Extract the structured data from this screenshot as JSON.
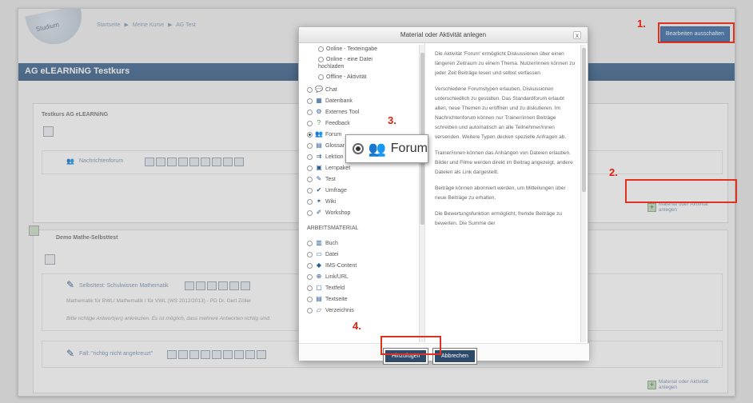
{
  "breadcrumb": [
    "Startseite",
    "▶",
    "Meine Kurse",
    "▶",
    "AG Test"
  ],
  "logo_text": "Studium",
  "edit_button": "Bearbeiten ausschalten",
  "course_title": "AG eLEARNiNG Testkurs",
  "sections": {
    "s0_title": "Testkurs AG eLEARNiNG",
    "forum_link": "Nachrichtenforum",
    "add_activity": "Material oder Aktivität anlegen",
    "s1_title": "Demo Mathe-Selbsttest",
    "quiz_link": "Selbsttest: Schulwissen Mathematik",
    "quiz_info": "Mathematik für BWL/ Mathematik I für VWL (WS 2012/2013) - PD Dr. Gert Zöller",
    "quiz_hint": "Bitte richtige Antwort(en) ankreuzen. Es ist möglich, dass mehrere Antworten richtig sind.",
    "case_link": "Fall: \"richtig nicht angekreuzt\"",
    "add_activity_bottom": "Material oder Aktivität anlegen"
  },
  "modal": {
    "title": "Material oder Aktivität anlegen",
    "close": "x",
    "items": [
      {
        "label": "Online - Texteingabe",
        "icon": "none"
      },
      {
        "label": "Online - eine Datei",
        "icon": "none"
      },
      {
        "label": "hochladen",
        "icon": "none"
      },
      {
        "label": "Offline - Aktivität",
        "icon": "none"
      },
      {
        "label": "Chat",
        "icon": "chat-icon"
      },
      {
        "label": "Datenbank",
        "icon": "database-icon"
      },
      {
        "label": "Externes Tool",
        "icon": "external-tool-icon"
      },
      {
        "label": "Feedback",
        "icon": "feedback-icon"
      },
      {
        "label": "Forum",
        "icon": "forum-icon"
      },
      {
        "label": "Glossar",
        "icon": "glossary-icon"
      },
      {
        "label": "Lektion",
        "icon": "lesson-icon"
      },
      {
        "label": "Lernpaket",
        "icon": "package-icon"
      },
      {
        "label": "Test",
        "icon": "quiz-icon"
      },
      {
        "label": "Umfrage",
        "icon": "survey-icon"
      },
      {
        "label": "Wiki",
        "icon": "wiki-icon"
      },
      {
        "label": "Workshop",
        "icon": "workshop-icon"
      }
    ],
    "category": "ARBEITSMATERIAL",
    "resources": [
      {
        "label": "Buch",
        "icon": "book-icon"
      },
      {
        "label": "Datei",
        "icon": "file-icon"
      },
      {
        "label": "IMS-Content",
        "icon": "ims-icon"
      },
      {
        "label": "Link/URL",
        "icon": "url-icon"
      },
      {
        "label": "Textfeld",
        "icon": "label-icon"
      },
      {
        "label": "Textseite",
        "icon": "page-icon"
      },
      {
        "label": "Verzeichnis",
        "icon": "folder-icon"
      }
    ],
    "description": [
      "Die Aktivität 'Forum' ermöglicht Diskussionen über einen längeren Zeitraum zu einem Thema. Nutzer/innen können zu jeder Zeit Beiträge lesen und selbst verfassen.",
      "Verschiedene Forumstypen erlauben, Diskussionen unterschiedlich zu gestalten. Das Standardforum erlaubt allen, neue Themen zu eröffnen und zu diskutieren. Im Nachrichtenforum können nur Trainer/innen Beiträge schreiben und automatisch an alle Teilnehmer/innen versenden. Weitere Typen decken spezielle Anfragen ab.",
      "Trainer/innen können das Anhängen von Dateien erlauben. Bilder und Filme werden direkt im Beitrag angezeigt, andere Dateien als Link dargestellt.",
      "Beiträge können abonniert werden, um Mitteilungen über neue Beiträge zu erhalten.",
      "Die Bewertungsfunktion ermöglicht, fremde Beiträge zu bewerten. Die Summe der"
    ],
    "add_button": "Hinzufügen",
    "cancel_button": "Abbrechen"
  },
  "callout": {
    "label": "Forum"
  },
  "steps": [
    "1.",
    "2.",
    "3.",
    "4."
  ],
  "colors": {
    "accent": "#3c6fa8",
    "highlight": "#e03020",
    "title_bar": "#3c6189"
  }
}
